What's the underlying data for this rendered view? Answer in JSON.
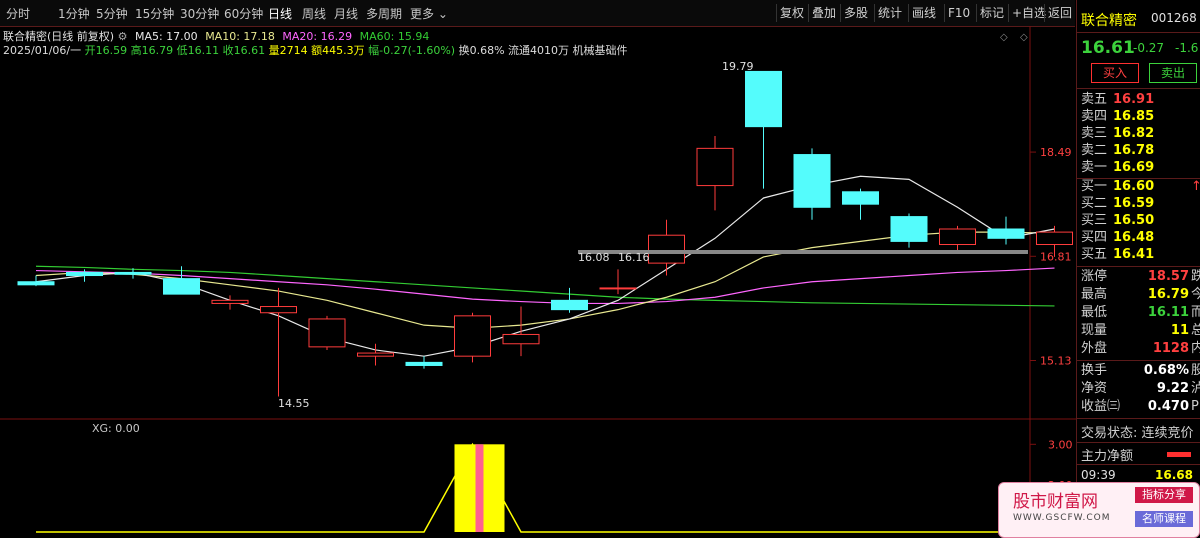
{
  "toolbar": {
    "tabs": [
      "分时",
      "1分钟",
      "5分钟",
      "15分钟",
      "30分钟",
      "60分钟",
      "日线",
      "周线",
      "月线",
      "多周期",
      "更多"
    ],
    "active_tab": "日线",
    "right_buttons": [
      "复权",
      "叠加",
      "多股",
      "统计",
      "画线",
      "F10",
      "标记",
      "+自选",
      "返回"
    ]
  },
  "chart": {
    "title": "联合精密(日线 前复权)",
    "ma_values": [
      "MA5: 17.00",
      "MA10: 17.18",
      "MA20: 16.29",
      "MA60: 15.94"
    ],
    "quote": {
      "date": "2025/01/06/一",
      "open": "开16.59",
      "high": "高16.79",
      "low": "低16.11",
      "close": "收16.61",
      "volume": "量2714",
      "amount": "额445.3万",
      "change": "幅-0.27(-1.60%)",
      "turnover": "换0.68%",
      "float_shares": "流通4010万",
      "sector": "机械基础件"
    },
    "price_axis": [
      "18.49",
      "16.81",
      "15.13"
    ],
    "annotations": {
      "high": "19.79",
      "low": "14.55",
      "range": "16.08",
      "range2": "16.16"
    },
    "indicator": {
      "label": "XG: 0.00",
      "axis": [
        "3.00",
        "2.00",
        "1.00"
      ]
    }
  },
  "chart_data": {
    "type": "candlestick",
    "candles": [
      {
        "o": 16.4,
        "h": 16.5,
        "l": 16.33,
        "c": 16.35
      },
      {
        "o": 16.55,
        "h": 16.6,
        "l": 16.4,
        "c": 16.5
      },
      {
        "o": 16.55,
        "h": 16.62,
        "l": 16.45,
        "c": 16.52
      },
      {
        "o": 16.45,
        "h": 16.65,
        "l": 16.2,
        "c": 16.2
      },
      {
        "o": 16.05,
        "h": 16.18,
        "l": 15.95,
        "c": 16.1
      },
      {
        "o": 15.9,
        "h": 16.3,
        "l": 14.55,
        "c": 16.0
      },
      {
        "o": 15.35,
        "h": 15.85,
        "l": 15.3,
        "c": 15.8
      },
      {
        "o": 15.2,
        "h": 15.4,
        "l": 15.05,
        "c": 15.25
      },
      {
        "o": 15.1,
        "h": 15.2,
        "l": 15.0,
        "c": 15.05
      },
      {
        "o": 15.2,
        "h": 15.9,
        "l": 15.1,
        "c": 15.85
      },
      {
        "o": 15.4,
        "h": 16.0,
        "l": 15.2,
        "c": 15.55
      },
      {
        "o": 16.1,
        "h": 16.3,
        "l": 15.9,
        "c": 15.95
      },
      {
        "o": 16.3,
        "h": 16.6,
        "l": 16.2,
        "c": 16.3
      },
      {
        "o": 16.7,
        "h": 17.4,
        "l": 16.5,
        "c": 17.15
      },
      {
        "o": 17.95,
        "h": 18.75,
        "l": 17.55,
        "c": 18.55
      },
      {
        "o": 19.79,
        "h": 19.79,
        "l": 17.9,
        "c": 18.9
      },
      {
        "o": 18.45,
        "h": 18.55,
        "l": 17.4,
        "c": 17.6
      },
      {
        "o": 17.85,
        "h": 17.9,
        "l": 17.4,
        "c": 17.65
      },
      {
        "o": 17.45,
        "h": 17.5,
        "l": 16.95,
        "c": 17.05
      },
      {
        "o": 17.0,
        "h": 17.3,
        "l": 16.85,
        "c": 17.25
      },
      {
        "o": 17.25,
        "h": 17.45,
        "l": 17.0,
        "c": 17.1
      },
      {
        "o": 17.0,
        "h": 17.3,
        "l": 16.8,
        "c": 17.2
      }
    ],
    "ma5": [
      16.4,
      16.5,
      16.55,
      16.38,
      16.1,
      15.85,
      15.5,
      15.3,
      15.2,
      15.35,
      15.6,
      15.8,
      16.1,
      16.6,
      17.1,
      17.75,
      17.95,
      18.1,
      18.05,
      17.6,
      17.1,
      17.25
    ],
    "ma10": [
      16.5,
      16.55,
      16.52,
      16.45,
      16.35,
      16.25,
      16.1,
      15.9,
      15.7,
      15.65,
      15.7,
      15.8,
      15.95,
      16.15,
      16.4,
      16.8,
      16.95,
      17.05,
      17.15,
      17.2,
      17.2,
      17.18
    ],
    "ma20": [
      16.58,
      16.56,
      16.54,
      16.5,
      16.45,
      16.4,
      16.35,
      16.28,
      16.2,
      16.12,
      16.08,
      16.05,
      16.05,
      16.08,
      16.15,
      16.3,
      16.4,
      16.45,
      16.5,
      16.55,
      16.58,
      16.62
    ],
    "ma60": [
      16.65,
      16.63,
      16.6,
      16.58,
      16.55,
      16.5,
      16.45,
      16.4,
      16.35,
      16.3,
      16.25,
      16.2,
      16.15,
      16.12,
      16.1,
      16.08,
      16.06,
      16.05,
      16.04,
      16.03,
      16.02,
      16.01
    ],
    "y_range": [
      14.3,
      20.2
    ],
    "indicator_values": [
      0,
      0,
      0,
      0,
      0,
      0,
      0,
      0,
      0,
      3,
      0,
      0,
      0,
      0,
      0,
      0,
      0,
      0,
      0,
      0,
      0,
      0
    ],
    "indicator_range": [
      0.8,
      3.4
    ],
    "colors": {
      "up": "#ff3c3c",
      "down": "#54fcfc",
      "ma5": "#e8e8e8",
      "ma10": "#e8e890",
      "ma20": "#ff66ff",
      "ma60": "#33cc33",
      "signal": "#ffff00"
    }
  },
  "right_panel": {
    "stock_name": "联合精密",
    "stock_code": "001268",
    "price": "16.61",
    "change": "-0.27",
    "change_pct": "-1.6",
    "buy_button": "买入",
    "sell_button": "卖出",
    "asks": [
      {
        "label": "卖五",
        "price": "16.91"
      },
      {
        "label": "卖四",
        "price": "16.85"
      },
      {
        "label": "卖三",
        "price": "16.82"
      },
      {
        "label": "卖二",
        "price": "16.78"
      },
      {
        "label": "卖一",
        "price": "16.69"
      }
    ],
    "bids": [
      {
        "label": "买一",
        "price": "16.60"
      },
      {
        "label": "买二",
        "price": "16.59"
      },
      {
        "label": "买三",
        "price": "16.50"
      },
      {
        "label": "买四",
        "price": "16.48"
      },
      {
        "label": "买五",
        "price": "16.41"
      }
    ],
    "stats": [
      {
        "label": "涨停",
        "value": "18.57",
        "suffix": "跌"
      },
      {
        "label": "最高",
        "value": "16.79",
        "suffix": "今"
      },
      {
        "label": "最低",
        "value": "16.11",
        "suffix": "而"
      },
      {
        "label": "现量",
        "value": "11",
        "suffix": "总"
      },
      {
        "label": "外盘",
        "value": "1128",
        "suffix": "内"
      }
    ],
    "stats2": [
      {
        "label": "换手",
        "value": "0.68%",
        "suffix": "股"
      },
      {
        "label": "净资",
        "value": "9.22",
        "suffix": "泸"
      },
      {
        "label": "收益㈢",
        "value": "0.470",
        "suffix": "P"
      }
    ],
    "trade_status": "交易状态: 连续竞价",
    "main_net": "主力净额",
    "tick_time": "09:39",
    "tick_price": "16.68"
  },
  "watermark": {
    "title": "股市财富网",
    "url": "WWW.GSCFW.COM",
    "tag1": "指标分享",
    "tag2": "名师课程"
  }
}
